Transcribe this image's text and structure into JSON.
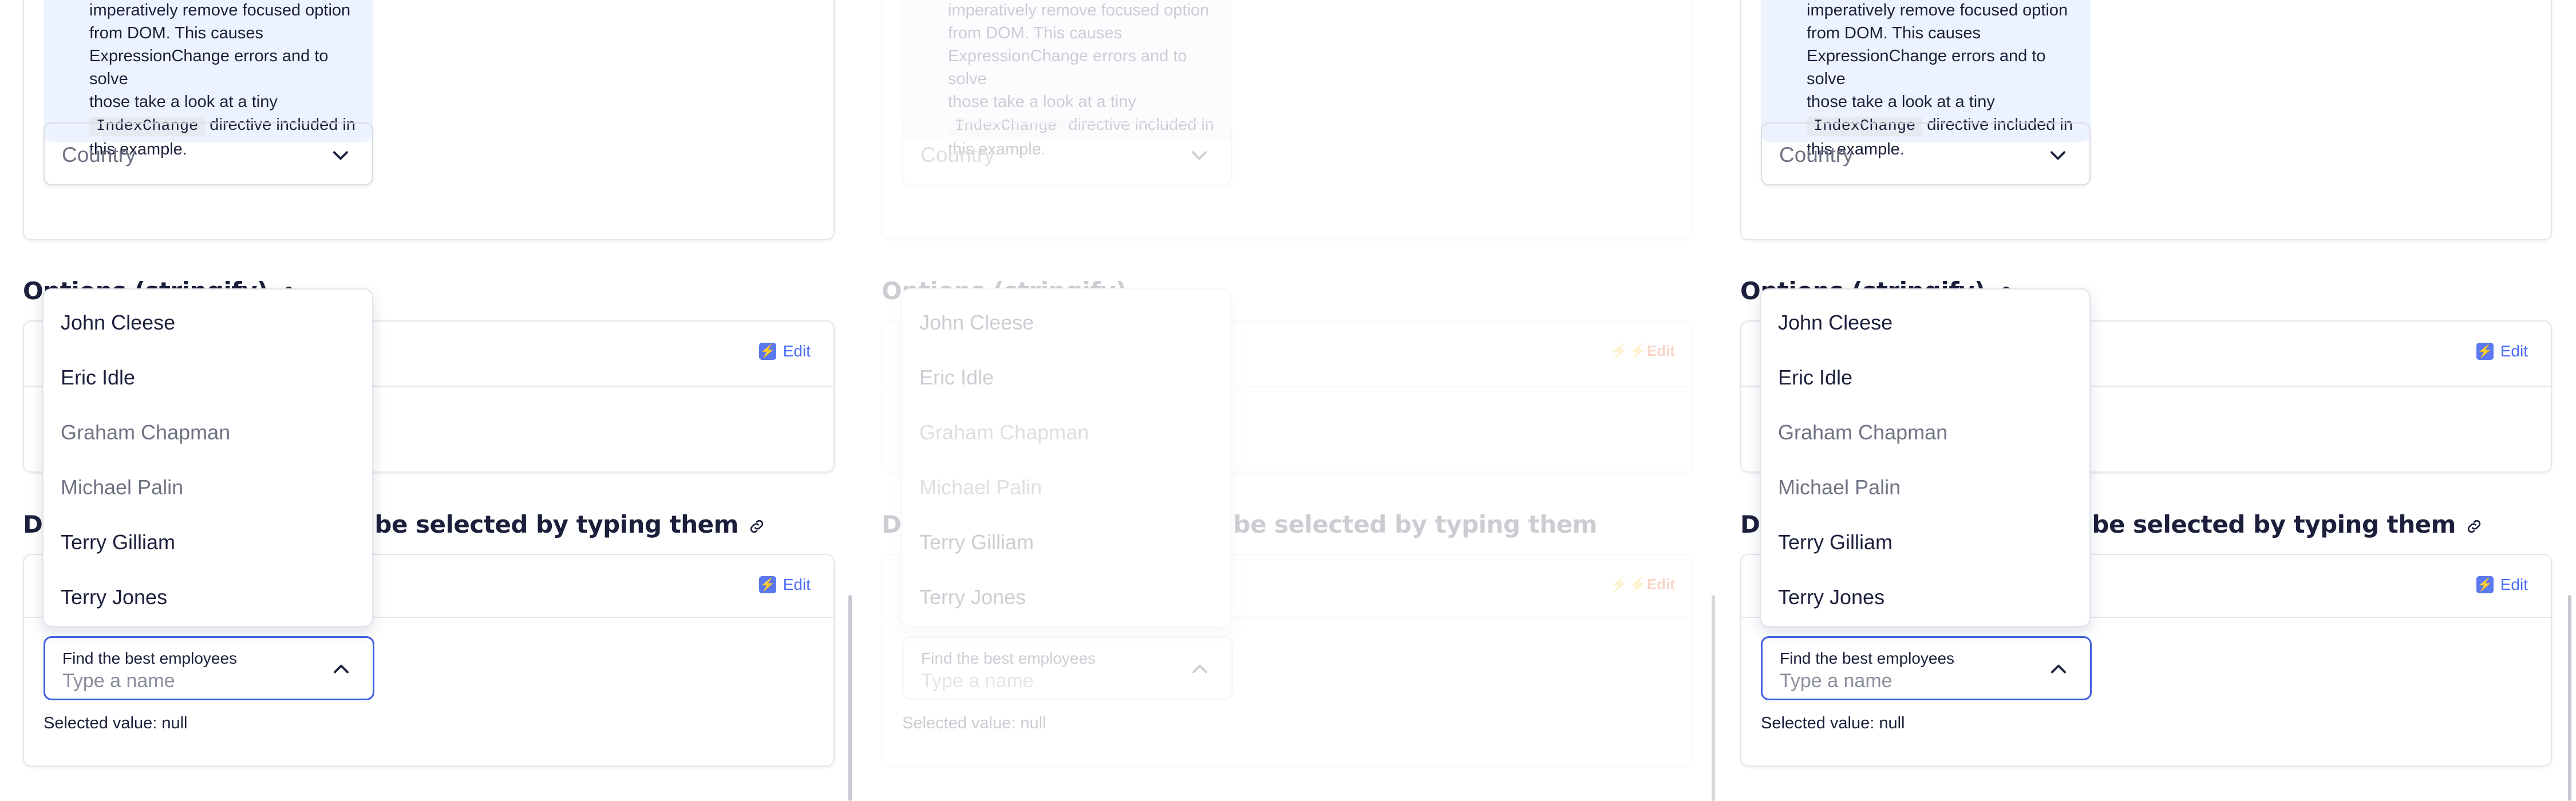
{
  "note": {
    "line1": "imperatively remove focused option",
    "line2": "from DOM. This causes",
    "line3": "ExpressionChange errors and to solve",
    "line4": "those take a look at a tiny",
    "code": "IndexChange",
    "line5": "directive included in",
    "line6": "this example."
  },
  "country_select": {
    "label": "Country"
  },
  "section_stringify": {
    "title": "Options (stringify)",
    "edit_label": "Edit"
  },
  "section_typing": {
    "title_visible": "be selected by typing them",
    "title_prefix": "D",
    "edit_label": "Edit"
  },
  "combobox": {
    "label": "Find the best employees",
    "placeholder": "Type a name"
  },
  "selected_value": "Selected value: null",
  "dropdown": {
    "options": [
      {
        "label": "John Cleese",
        "state": "enabled"
      },
      {
        "label": "Eric Idle",
        "state": "enabled"
      },
      {
        "label": "Graham Chapman",
        "state": "disabled"
      },
      {
        "label": "Michael Palin",
        "state": "disabled"
      },
      {
        "label": "Terry Gilliam",
        "state": "enabled"
      },
      {
        "label": "Terry Jones",
        "state": "enabled"
      }
    ]
  },
  "colors": {
    "accent": "#3f5fe0",
    "note_bg": "#edf3fe",
    "text": "#1b1f3b",
    "muted": "#6e7282"
  }
}
